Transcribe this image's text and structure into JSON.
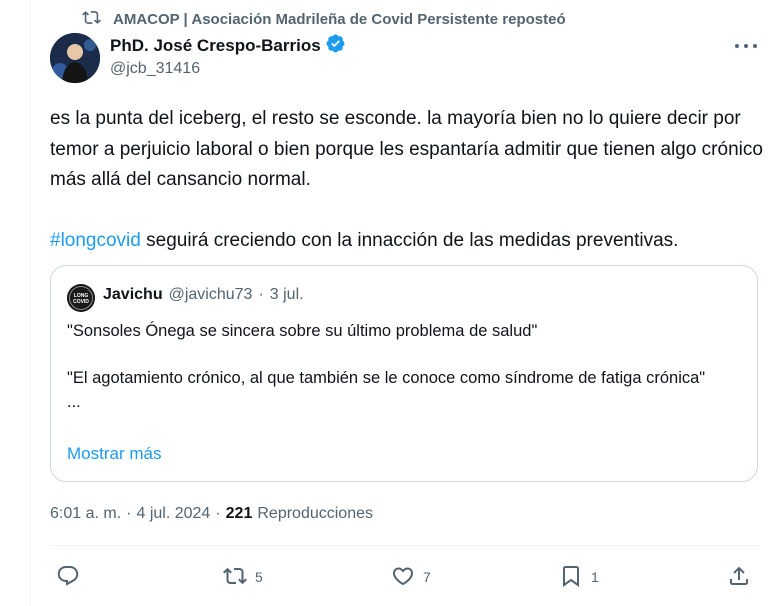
{
  "repost": {
    "icon": "repost-icon",
    "text": "AMACOP | Asociación Madrileña de Covid Persistente reposteó"
  },
  "author": {
    "name": "PhD. José Crespo-Barrios",
    "handle": "@jcb_31416",
    "verified": true,
    "verified_color": "#1d9bf0"
  },
  "tweet": {
    "text_before_hashtag": "es la punta del iceberg, el resto se esconde. la mayoría bien no lo quiere decir por temor a perjuicio laboral o bien porque les espantaría admitir que tienen algo crónico más allá del cansancio normal.\n\n",
    "hashtag": "#longcovid",
    "text_after_hashtag": " seguirá creciendo con la innacción de las medidas preventivas."
  },
  "quote": {
    "name": "Javichu",
    "handle": "@javichu73",
    "separator": "·",
    "date": "3 jul.",
    "avatar_text": "LONG COVID",
    "body": "\"Sonsoles Ónega se sincera sobre su último problema de salud\"\n\n\"El agotamiento crónico, al que también se le conoce como síndrome de fatiga crónica\"\n...",
    "show_more": "Mostrar más"
  },
  "meta": {
    "time": "6:01 a. m.",
    "sep1": "·",
    "date": "4 jul. 2024",
    "sep2": "·",
    "views_count": "221",
    "views_label": "Reproducciones"
  },
  "actions": {
    "reply": {
      "icon": "reply-icon",
      "count": ""
    },
    "repost": {
      "icon": "repost-icon",
      "count": "5"
    },
    "like": {
      "icon": "heart-icon",
      "count": "7"
    },
    "bookmark": {
      "icon": "bookmark-icon",
      "count": "1"
    },
    "share": {
      "icon": "share-icon",
      "count": ""
    }
  },
  "colors": {
    "accent": "#1d9bf0",
    "secondary_text": "#536471",
    "primary_text": "#0f1419",
    "border": "#cfd9de"
  }
}
